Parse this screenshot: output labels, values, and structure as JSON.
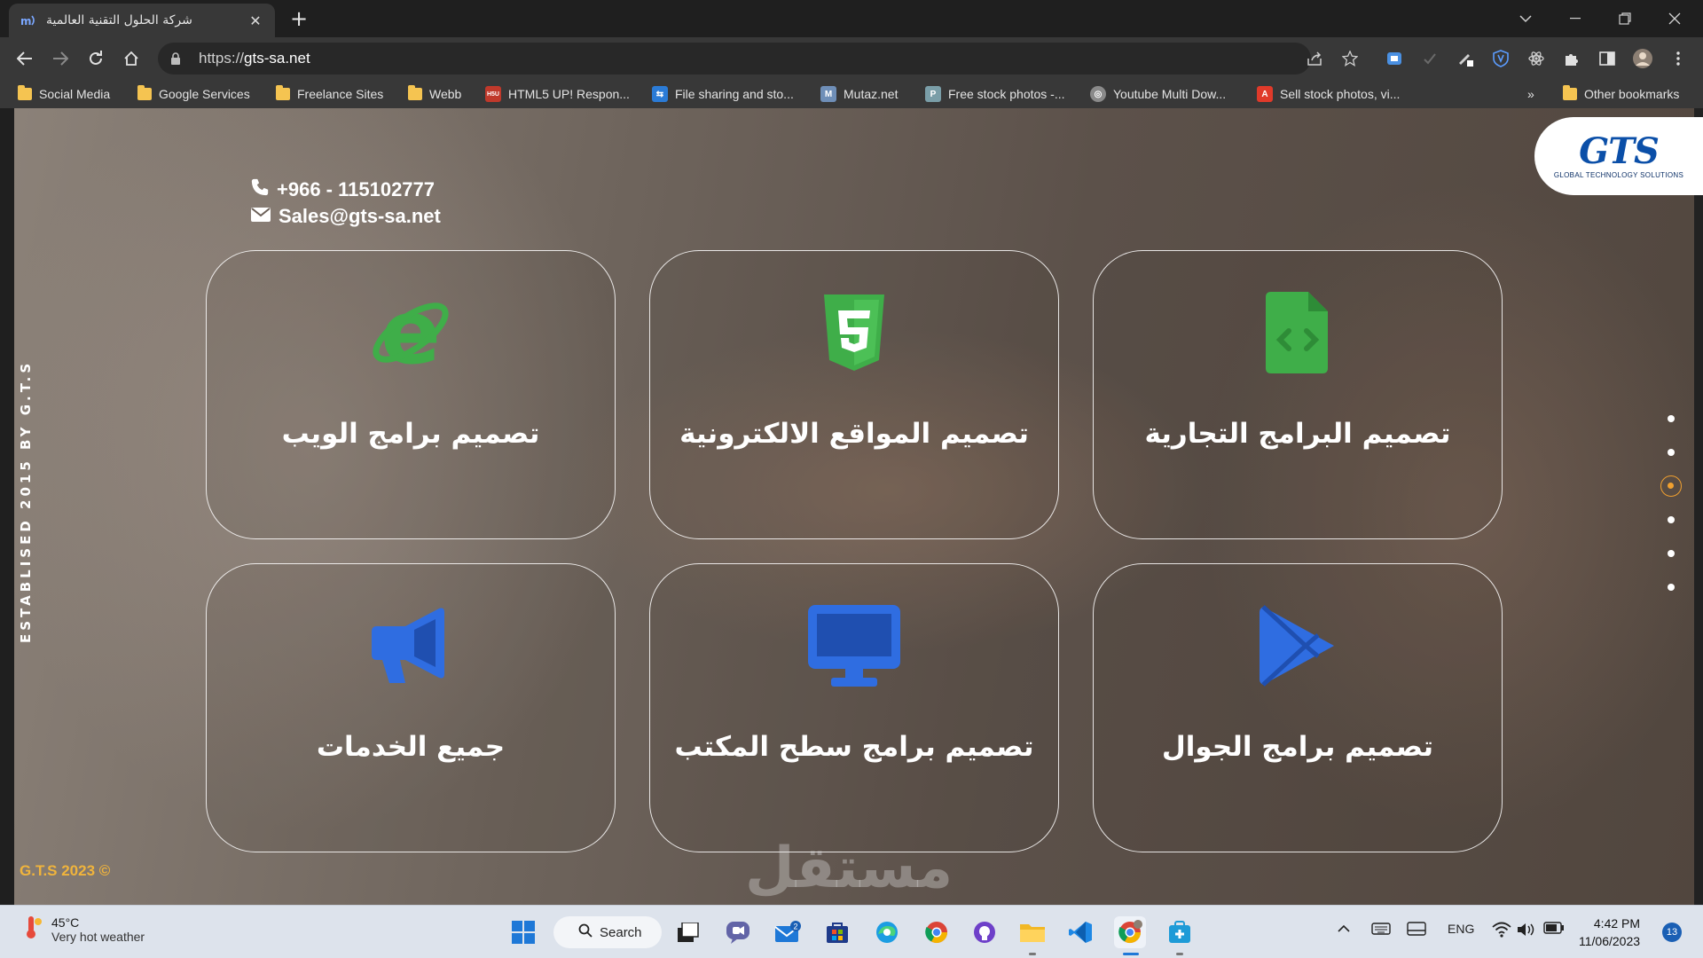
{
  "browser": {
    "tab_title": "شركة الحلول التقنية العالمية",
    "url_scheme": "https://",
    "url_host": "gts-sa.net",
    "bookmarks": [
      {
        "label": "Social Media",
        "type": "folder"
      },
      {
        "label": "Google Services",
        "type": "folder"
      },
      {
        "label": "Freelance Sites",
        "type": "folder"
      },
      {
        "label": "Webb",
        "type": "folder"
      },
      {
        "label": "HTML5 UP! Respon...",
        "type": "site",
        "color": "#c0392b",
        "badge": "H5U"
      },
      {
        "label": "File sharing and sto...",
        "type": "site",
        "color": "#2b7bd6",
        "badge": "⇆"
      },
      {
        "label": "Mutaz.net",
        "type": "site",
        "color": "#6f8fb8",
        "badge": "M"
      },
      {
        "label": "Free stock photos -...",
        "type": "site",
        "color": "#7a9ea8",
        "badge": "P"
      },
      {
        "label": "Youtube Multi Dow...",
        "type": "site",
        "color": "#8a8a8a",
        "badge": "◎"
      },
      {
        "label": "Sell stock photos, vi...",
        "type": "site",
        "color": "#e03a2a",
        "badge": "A"
      }
    ],
    "overflow_label": "»",
    "other_bookmarks": "Other bookmarks"
  },
  "page": {
    "logo_text": "GTS",
    "logo_subtitle": "GLOBAL TECHNOLOGY SOLUTIONS",
    "phone": "+966 - 115102777",
    "email": "Sales@gts-sa.net",
    "established": "ESTABLISED 2015 BY G.T.S",
    "copyright": "G.T.S 2023 ©",
    "watermark": "مستقل",
    "services": [
      {
        "label": "تصميم برامج الويب",
        "icon": "internet-explorer-icon",
        "color": "#3fae49"
      },
      {
        "label": "تصميم المواقع الالكترونية",
        "icon": "html5-icon",
        "color": "#3fae49"
      },
      {
        "label": "تصميم البرامج التجارية",
        "icon": "code-file-icon",
        "color": "#3fae49"
      },
      {
        "label": "جميع الخدمات",
        "icon": "megaphone-icon",
        "color": "#2f6de1"
      },
      {
        "label": "تصميم برامج سطح المكتب",
        "icon": "desktop-monitor-icon",
        "color": "#2f6de1"
      },
      {
        "label": "تصميم برامج الجوال",
        "icon": "google-play-icon",
        "color": "#2f6de1"
      }
    ],
    "pagination": {
      "count": 6,
      "active": 3,
      "accent": "#f0a030"
    }
  },
  "taskbar": {
    "temperature": "45°C",
    "weather": "Very hot weather",
    "search_label": "Search",
    "mail_badge": "2",
    "language": "ENG",
    "time": "4:42 PM",
    "date": "11/06/2023",
    "notifications": "13"
  }
}
